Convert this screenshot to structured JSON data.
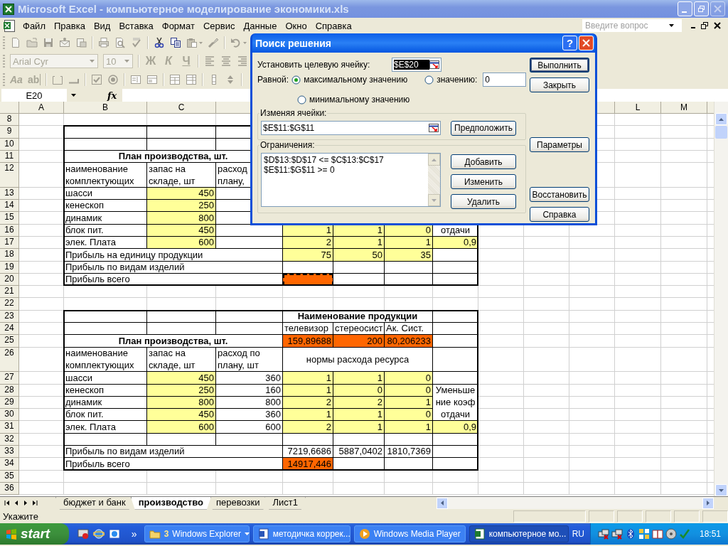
{
  "window": {
    "title": "Microsoft Excel - компьютерное моделирование экономики.xls"
  },
  "menu": [
    {
      "label": "Файл"
    },
    {
      "label": "Правка"
    },
    {
      "label": "Вид"
    },
    {
      "label": "Вставка"
    },
    {
      "label": "Формат"
    },
    {
      "label": "Сервис"
    },
    {
      "label": "Данные"
    },
    {
      "label": "Окно"
    },
    {
      "label": "Справка"
    }
  ],
  "help_box": {
    "placeholder": "Введите вопрос"
  },
  "format_toolbar": {
    "font": "Arial Cyr",
    "size": "10",
    "styles": [
      {
        "label": "Ж",
        "kind": "bold"
      },
      {
        "label": "К",
        "kind": "italic"
      },
      {
        "label": "Ч",
        "kind": "underline"
      }
    ]
  },
  "forms_toolbar": {
    "tools": [
      {
        "label": "Aa",
        "kind": "label"
      },
      {
        "label": "ab",
        "kind": "edit"
      }
    ]
  },
  "formula_bar": {
    "name_box": "E20",
    "fx": "fx"
  },
  "sheet": {
    "column_headers": {
      "A": "A",
      "B": "B",
      "C": "C",
      "L": "L",
      "M": "M"
    },
    "rows": [
      {
        "label": "8"
      },
      {
        "label": "9"
      },
      {
        "label": "10"
      },
      {
        "label": "11",
        "cells": {
          "B": {
            "text": "План производства, шт.",
            "kind": "title"
          }
        }
      },
      {
        "label": "12",
        "cells": {
          "B": {
            "text": "наименование\nкомплектующих",
            "kind": "text"
          },
          "C": {
            "text": "запас на\nскладе, шт",
            "kind": "text"
          },
          "D": {
            "text": "расход\nплану,",
            "kind": "text"
          }
        }
      },
      {
        "label": "13",
        "cells": {
          "B": {
            "text": "шасси",
            "kind": "text"
          },
          "C": {
            "text": "450",
            "kind": "number",
            "color": "#ffff99"
          }
        }
      },
      {
        "label": "14",
        "cells": {
          "B": {
            "text": "кенескоп",
            "kind": "text"
          },
          "C": {
            "text": "250",
            "kind": "number",
            "color": "#ffff99"
          }
        }
      },
      {
        "label": "15",
        "cells": {
          "B": {
            "text": "динамик",
            "kind": "text"
          },
          "C": {
            "text": "800",
            "kind": "number",
            "color": "#ffff99"
          }
        }
      },
      {
        "label": "16",
        "cells": {
          "B": {
            "text": "блок пит.",
            "kind": "text"
          },
          "C": {
            "text": "450",
            "kind": "number",
            "color": "#ffff99"
          },
          "E": {
            "text": "1",
            "kind": "number",
            "color": "#ffff99"
          },
          "F": {
            "text": "1",
            "kind": "number",
            "color": "#ffff99"
          },
          "G": {
            "text": "0",
            "kind": "number",
            "color": "#ffff99"
          },
          "H": {
            "text": "отдачи",
            "kind": "center"
          }
        }
      },
      {
        "label": "17",
        "cells": {
          "B": {
            "text": "элек. Плата",
            "kind": "text"
          },
          "C": {
            "text": "600",
            "kind": "number",
            "color": "#ffff99"
          },
          "E": {
            "text": "2",
            "kind": "number",
            "color": "#ffff99"
          },
          "F": {
            "text": "1",
            "kind": "number",
            "color": "#ffff99"
          },
          "G": {
            "text": "1",
            "kind": "number",
            "color": "#ffff99"
          },
          "H": {
            "text": "0,9",
            "kind": "number",
            "color": "#ffff99"
          }
        }
      },
      {
        "label": "18",
        "cells": {
          "B": {
            "text": "Прибыль на единицу продукции",
            "kind": "wide"
          },
          "E": {
            "text": "75",
            "kind": "number",
            "color": "#ffff99"
          },
          "F": {
            "text": "50",
            "kind": "number",
            "color": "#ffff99"
          },
          "G": {
            "text": "35",
            "kind": "number",
            "color": "#ffff99"
          }
        }
      },
      {
        "label": "19",
        "cells": {
          "B": {
            "text": "Прибыль по видам изделий",
            "kind": "wide"
          }
        }
      },
      {
        "label": "20",
        "cells": {
          "B": {
            "text": "Прибыль всего",
            "kind": "wide"
          },
          "E": {
            "kind": "marquee",
            "color": "#ff6600"
          }
        }
      },
      {
        "label": "21"
      },
      {
        "label": "22"
      },
      {
        "label": "23",
        "cells": {
          "E": {
            "text": "Наименование продукции",
            "kind": "title"
          }
        }
      },
      {
        "label": "24",
        "cells": {
          "E": {
            "text": "телевизор",
            "kind": "text"
          },
          "F": {
            "text": "стереосист",
            "kind": "text"
          },
          "G": {
            "text": "Ак. Сист.",
            "kind": "text"
          }
        }
      },
      {
        "label": "25",
        "cells": {
          "B": {
            "text": "План производства, шт.",
            "kind": "title"
          },
          "E": {
            "text": "159,89688",
            "kind": "number",
            "color": "#ff6600"
          },
          "F": {
            "text": "200",
            "kind": "number",
            "color": "#ff6600"
          },
          "G": {
            "text": "80,206233",
            "kind": "number",
            "color": "#ff6600"
          }
        }
      },
      {
        "label": "26",
        "cells": {
          "B": {
            "text": "наименование\nкомплектующих",
            "kind": "text"
          },
          "C": {
            "text": "запас на\nскладе, шт",
            "kind": "text"
          },
          "D": {
            "text": "расход по\nплану, шт",
            "kind": "text"
          },
          "E": {
            "text": "нормы расхода ресурса",
            "kind": "band"
          }
        }
      },
      {
        "label": "27",
        "cells": {
          "B": {
            "text": "шасси",
            "kind": "text"
          },
          "C": {
            "text": "450",
            "kind": "number",
            "color": "#ffff99"
          },
          "D": {
            "text": "360",
            "kind": "number"
          },
          "E": {
            "text": "1",
            "kind": "number",
            "color": "#ffff99"
          },
          "F": {
            "text": "1",
            "kind": "number",
            "color": "#ffff99"
          },
          "G": {
            "text": "0",
            "kind": "number",
            "color": "#ffff99"
          }
        }
      },
      {
        "label": "28",
        "cells": {
          "B": {
            "text": "кенескоп",
            "kind": "text"
          },
          "C": {
            "text": "250",
            "kind": "number",
            "color": "#ffff99"
          },
          "D": {
            "text": "160",
            "kind": "number"
          },
          "E": {
            "text": "1",
            "kind": "number",
            "color": "#ffff99"
          },
          "F": {
            "text": "0",
            "kind": "number",
            "color": "#ffff99"
          },
          "G": {
            "text": "0",
            "kind": "number",
            "color": "#ffff99"
          },
          "H": {
            "text": "Уменьше\nние коэф\nотдачи",
            "kind": "note"
          }
        }
      },
      {
        "label": "29",
        "cells": {
          "B": {
            "text": "динамик",
            "kind": "text"
          },
          "C": {
            "text": "800",
            "kind": "number",
            "color": "#ffff99"
          },
          "D": {
            "text": "800",
            "kind": "number"
          },
          "E": {
            "text": "2",
            "kind": "number",
            "color": "#ffff99"
          },
          "F": {
            "text": "2",
            "kind": "number",
            "color": "#ffff99"
          },
          "G": {
            "text": "1",
            "kind": "number",
            "color": "#ffff99"
          }
        }
      },
      {
        "label": "30",
        "cells": {
          "B": {
            "text": "блок пит.",
            "kind": "text"
          },
          "C": {
            "text": "450",
            "kind": "number",
            "color": "#ffff99"
          },
          "D": {
            "text": "360",
            "kind": "number"
          },
          "E": {
            "text": "1",
            "kind": "number",
            "color": "#ffff99"
          },
          "F": {
            "text": "1",
            "kind": "number",
            "color": "#ffff99"
          },
          "G": {
            "text": "0",
            "kind": "number",
            "color": "#ffff99"
          }
        }
      },
      {
        "label": "31",
        "cells": {
          "B": {
            "text": "элек. Плата",
            "kind": "text"
          },
          "C": {
            "text": "600",
            "kind": "number",
            "color": "#ffff99"
          },
          "D": {
            "text": "600",
            "kind": "number"
          },
          "E": {
            "text": "2",
            "kind": "number",
            "color": "#ffff99"
          },
          "F": {
            "text": "1",
            "kind": "number",
            "color": "#ffff99"
          },
          "G": {
            "text": "1",
            "kind": "number",
            "color": "#ffff99"
          },
          "H": {
            "text": "0,9",
            "kind": "number",
            "color": "#ffff99"
          }
        }
      },
      {
        "label": "32"
      },
      {
        "label": "33",
        "cells": {
          "B": {
            "text": "Прибыль по видам изделий",
            "kind": "wide"
          },
          "E": {
            "text": "7219,6686",
            "kind": "number"
          },
          "F": {
            "text": "5887,0402",
            "kind": "number"
          },
          "G": {
            "text": "1810,7369",
            "kind": "number"
          }
        }
      },
      {
        "label": "34",
        "cells": {
          "B": {
            "text": "Прибыль всего",
            "kind": "wide"
          },
          "E": {
            "text": "14917,446",
            "kind": "number",
            "color": "#ff6600"
          }
        }
      },
      {
        "label": "35"
      },
      {
        "label": "36"
      }
    ]
  },
  "dialog": {
    "title": "Поиск решения",
    "help": "?",
    "target_label": "Установить целевую ячейку:",
    "target_value": "$E$20",
    "equal_label": "Равной:",
    "options": [
      {
        "label": "максимальному значению",
        "selected": true
      },
      {
        "label": "значению:",
        "selected": false
      },
      {
        "label": "минимальному значению",
        "selected": false
      }
    ],
    "value": "0",
    "changing_label": "Изменяя ячейки:",
    "changing_value": "$E$11:$G$11",
    "guess_button": "Предположить",
    "constraints_label": "Ограничения:",
    "constraints": [
      "$D$13:$D$17 <= $C$13:$C$17",
      "$E$11:$G$11 >= 0"
    ],
    "constraint_buttons": [
      "Добавить",
      "Изменить",
      "Удалить"
    ],
    "side_buttons": [
      {
        "label": "Выполнить",
        "default": true
      },
      {
        "label": "Закрыть",
        "default": false
      },
      {
        "label": "Параметры",
        "default": false
      },
      {
        "label": "Восстановить",
        "default": false
      },
      {
        "label": "Справка",
        "default": false
      }
    ]
  },
  "sheet_tabs": [
    {
      "label": "бюджет и банк",
      "selected": false
    },
    {
      "label": "производство",
      "selected": true
    },
    {
      "label": "перевозки",
      "selected": false
    },
    {
      "label": "Лист1",
      "selected": false
    }
  ],
  "status_bar": {
    "text": "Укажите"
  },
  "taskbar": {
    "start": "start",
    "more": "»",
    "tasks": [
      {
        "kind": "group",
        "count": "3",
        "label": "Windows Explorer",
        "selected": false
      },
      {
        "kind": "single",
        "label": "методичка коррек...",
        "selected": false
      },
      {
        "kind": "single",
        "label": "Windows Media Player",
        "selected": false
      },
      {
        "kind": "single",
        "label": "компьютерное мо...",
        "selected": true
      }
    ],
    "language": "RU",
    "clock": "18:51"
  }
}
